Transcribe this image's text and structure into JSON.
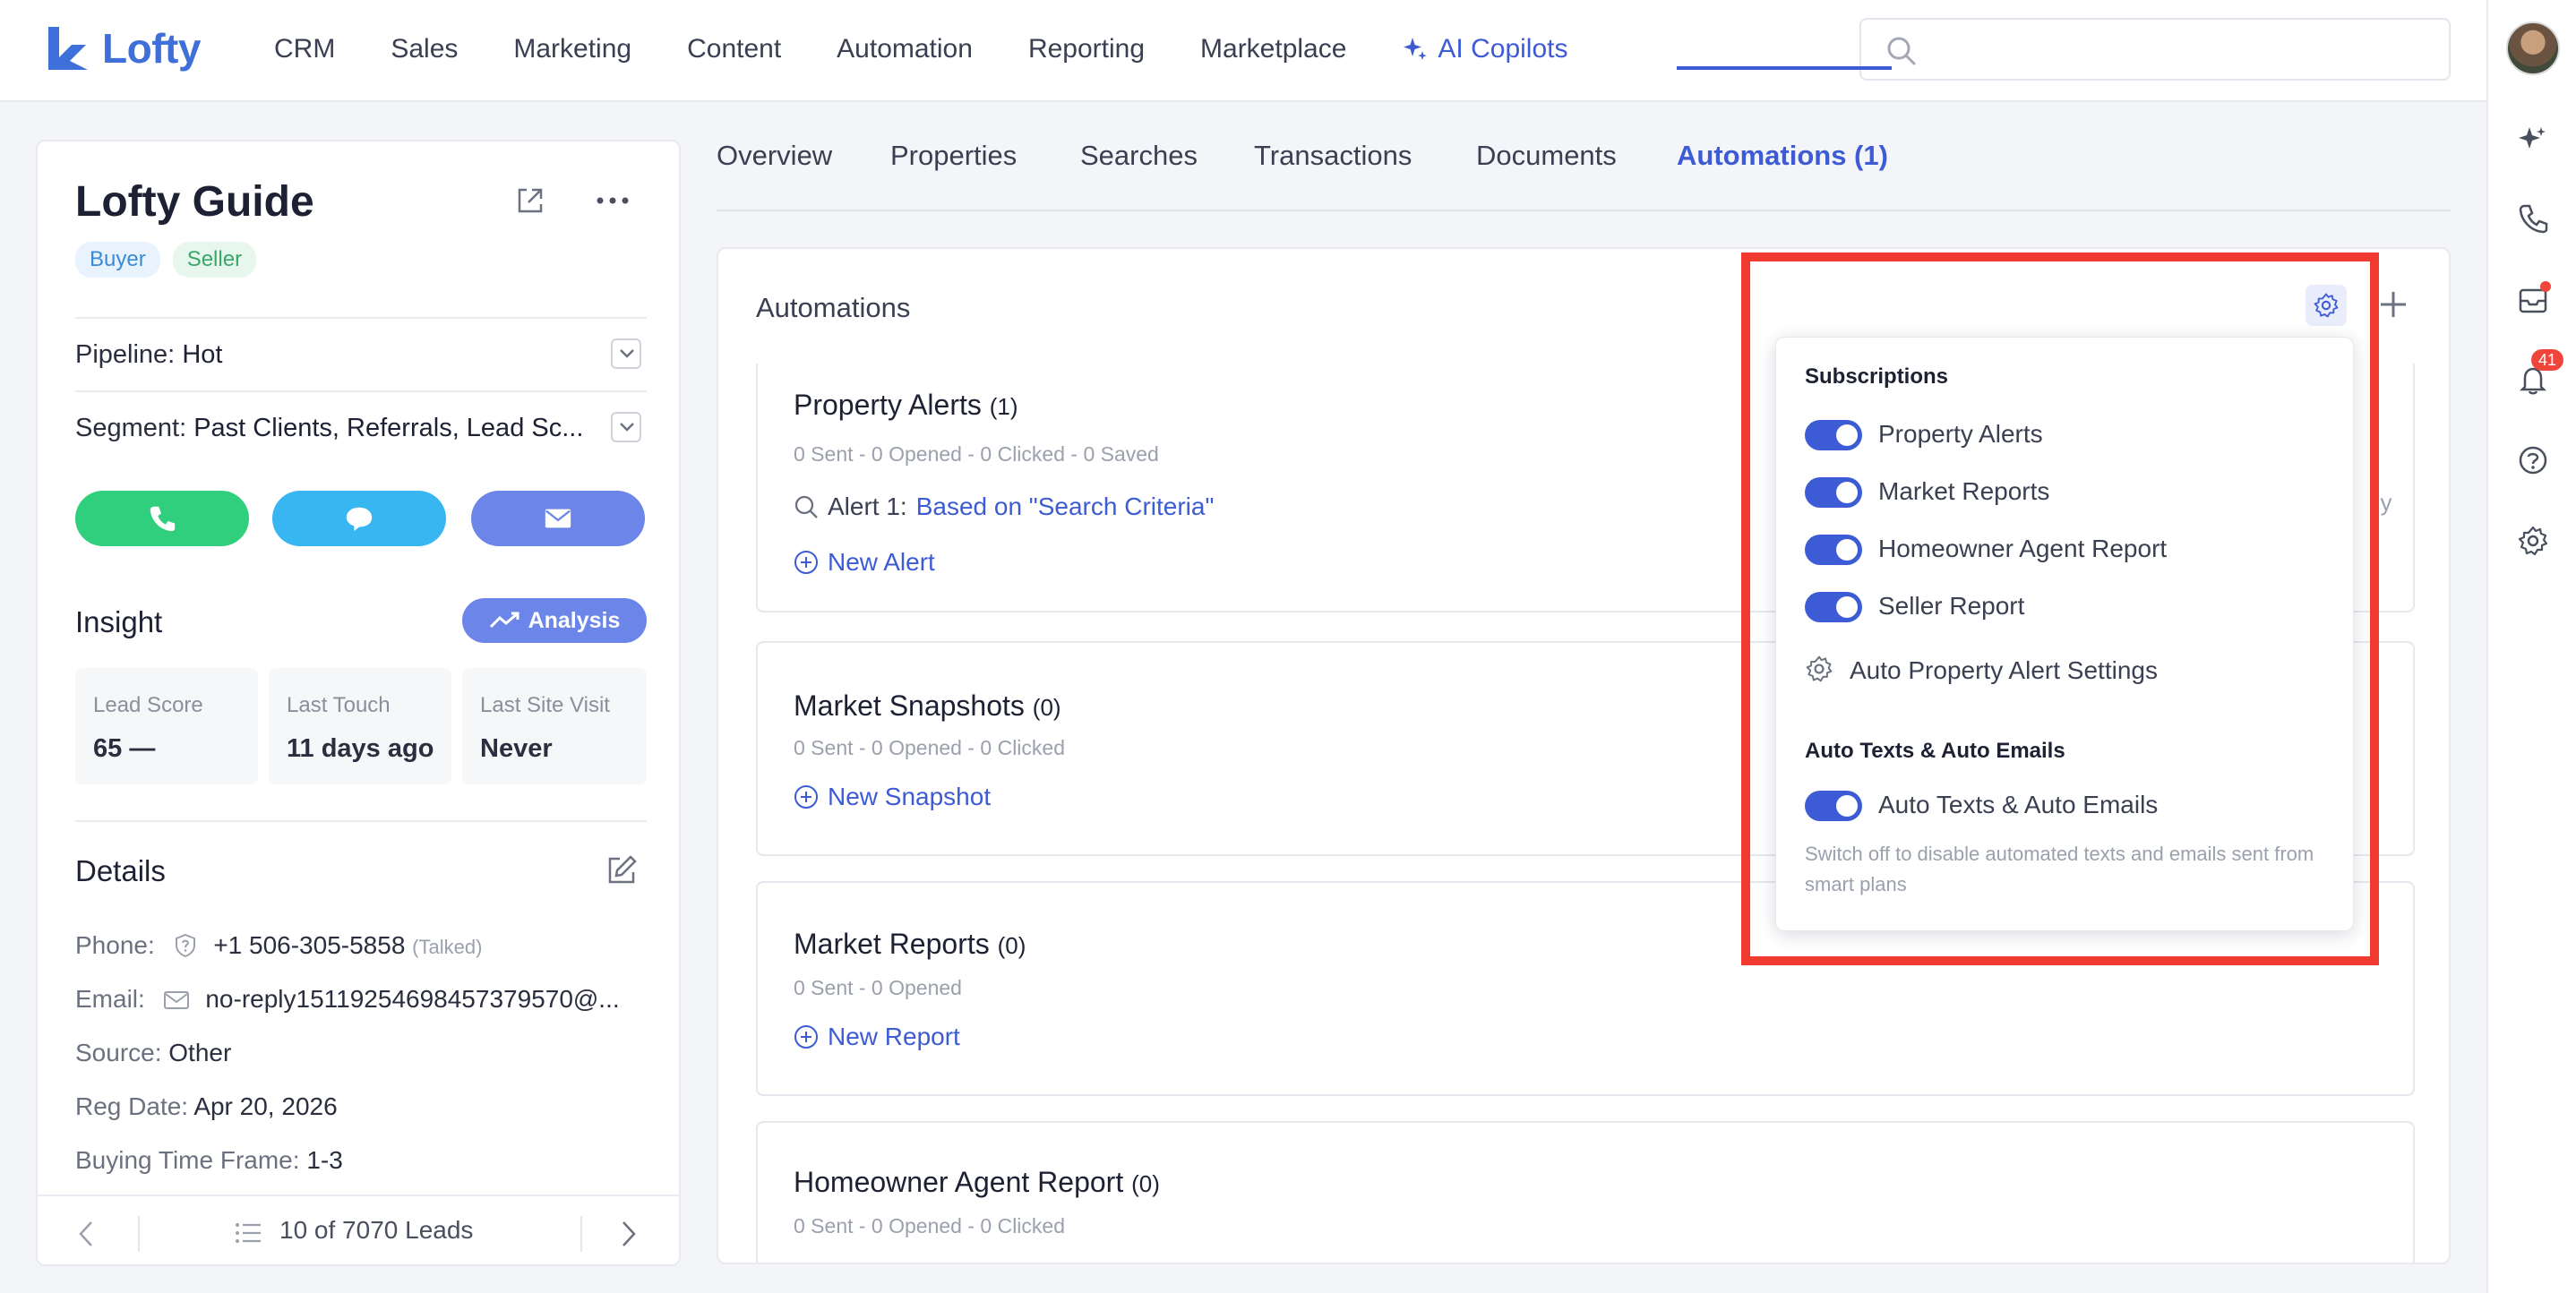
{
  "app": {
    "logo_text": "Lofty"
  },
  "nav": {
    "items": [
      "CRM",
      "Sales",
      "Marketing",
      "Content",
      "Automation",
      "Reporting",
      "Marketplace"
    ],
    "ai_label": "AI Copilots",
    "search_placeholder": ""
  },
  "rail": {
    "notification_count": "41"
  },
  "lead": {
    "name": "Lofty Guide",
    "tags": [
      "Buyer",
      "Seller"
    ],
    "pipeline_label": "Pipeline:",
    "pipeline_value": "Hot",
    "segment_label": "Segment:",
    "segment_value": "Past Clients, Referrals, Lead Sc...",
    "insight_title": "Insight",
    "analysis_label": "Analysis",
    "stats": [
      {
        "label": "Lead Score",
        "value": "65 —"
      },
      {
        "label": "Last Touch",
        "value": "11 days ago"
      },
      {
        "label": "Last Site Visit",
        "value": "Never"
      }
    ],
    "details_title": "Details",
    "details": {
      "phone_label": "Phone:",
      "phone_value": "+1 506-305-5858",
      "phone_status": "(Talked)",
      "email_label": "Email:",
      "email_value": "no-reply15119254698457379570@...",
      "source_label": "Source:",
      "source_value": "Other",
      "reg_label": "Reg Date:",
      "reg_value": "Apr 20, 2026",
      "btf_label": "Buying Time Frame:",
      "btf_value": "1-3"
    },
    "pager_text": "10 of 7070 Leads"
  },
  "tabs": [
    "Overview",
    "Properties",
    "Searches",
    "Transactions",
    "Documents",
    "Automations (1)"
  ],
  "automations": {
    "title": "Automations",
    "sections": [
      {
        "title": "Property Alerts",
        "count": "(1)",
        "stats": "0 Sent - 0 Opened - 0 Clicked - 0 Saved",
        "alert_label": "Alert 1:",
        "alert_value": "Based on \"Search Criteria\"",
        "link": "New Alert"
      },
      {
        "title": "Market Snapshots",
        "count": "(0)",
        "stats": "0 Sent - 0 Opened - 0 Clicked",
        "link": "New Snapshot"
      },
      {
        "title": "Market Reports",
        "count": "(0)",
        "stats": "0 Sent - 0 Opened",
        "link": "New Report"
      },
      {
        "title": "Homeowner Agent Report",
        "count": "(0)",
        "stats": "0 Sent - 0 Opened - 0 Clicked"
      }
    ],
    "partial_text": "ily"
  },
  "popover": {
    "subs_heading": "Subscriptions",
    "toggles": [
      "Property Alerts",
      "Market Reports",
      "Homeowner Agent Report",
      "Seller Report"
    ],
    "settings_link": "Auto Property Alert Settings",
    "auto_heading": "Auto Texts & Auto Emails",
    "auto_toggle": "Auto Texts & Auto Emails",
    "auto_note": "Switch off to disable automated texts and emails sent from smart plans"
  },
  "colors": {
    "accent": "#3d5bd4",
    "call": "#2fcf7d",
    "sms": "#37b6f2",
    "email": "#6b86e8",
    "highlight": "#f03a30"
  }
}
